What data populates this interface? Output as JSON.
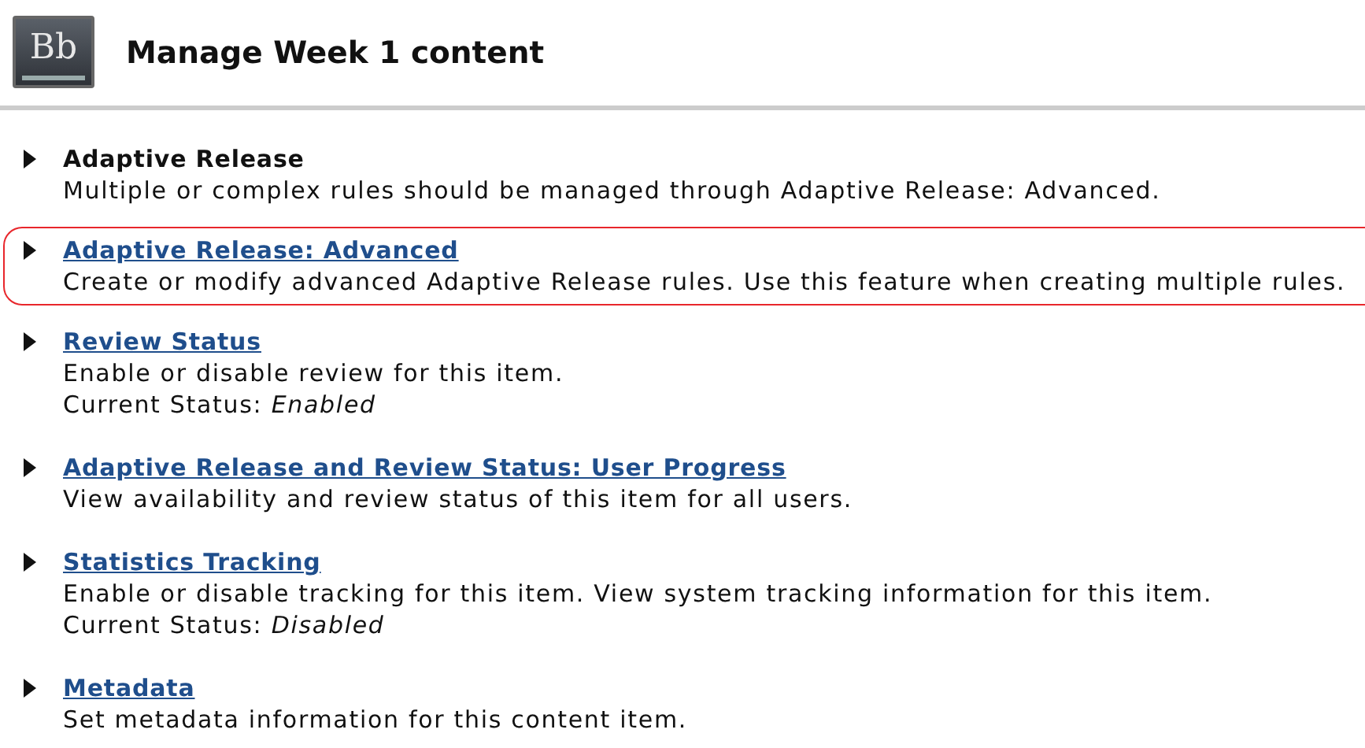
{
  "header": {
    "logo": "Bb",
    "title": "Manage Week 1 content"
  },
  "items": [
    {
      "kind": "heading",
      "title": "Adaptive Release",
      "description": "Multiple or complex rules should be managed through Adaptive Release: Advanced.",
      "highlighted": false
    },
    {
      "kind": "link",
      "title": "Adaptive Release: Advanced",
      "description": "Create or modify advanced Adaptive Release rules. Use this feature when creating multiple rules.",
      "highlighted": true
    },
    {
      "kind": "link",
      "title": "Review Status",
      "description": "Enable or disable review for this item.",
      "status": "Current Status: *Enabled*",
      "highlighted": false
    },
    {
      "kind": "link",
      "title": "Adaptive Release and Review Status: User Progress",
      "description": "View availability and review status of this item for all users.",
      "highlighted": false
    },
    {
      "kind": "link",
      "title": "Statistics Tracking",
      "description": "Enable or disable tracking for this item. View system tracking information for this item.",
      "status": "Current Status: *Disabled*",
      "highlighted": false
    },
    {
      "kind": "link",
      "title": "Metadata",
      "description": "Set metadata information for this content item.",
      "highlighted": false
    }
  ]
}
